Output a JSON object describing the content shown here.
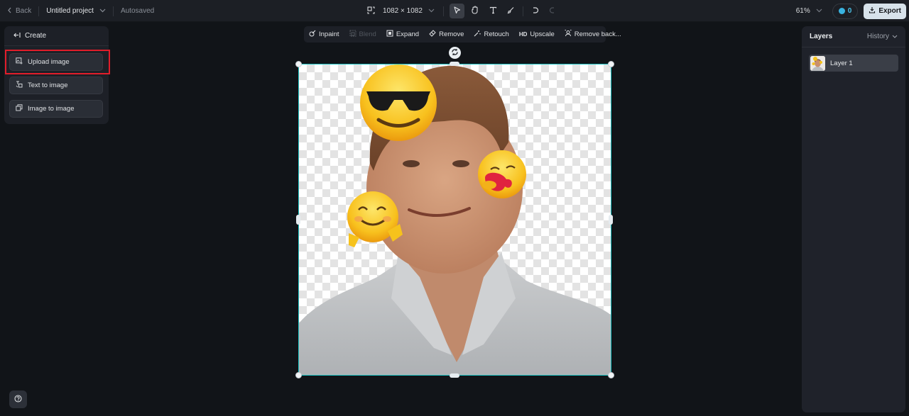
{
  "topbar": {
    "back_label": "Back",
    "project_name": "Untitled project",
    "save_status": "Autosaved",
    "canvas_size": "1082 × 1082",
    "zoom_level": "61%",
    "credits": "0",
    "export_label": "Export"
  },
  "tools": [
    {
      "name": "resize-icon"
    },
    {
      "name": "select-icon",
      "active": true
    },
    {
      "name": "hand-icon"
    },
    {
      "name": "text-icon"
    },
    {
      "name": "brush-icon"
    },
    {
      "name": "undo-icon"
    },
    {
      "name": "redo-icon",
      "disabled": true
    }
  ],
  "create_panel": {
    "title": "Create",
    "items": [
      {
        "label": "Upload image",
        "icon": "upload-image-icon",
        "highlighted": true
      },
      {
        "label": "Text to image",
        "icon": "text-to-image-icon"
      },
      {
        "label": "Image to image",
        "icon": "image-to-image-icon"
      }
    ]
  },
  "edit_toolbar": {
    "items": [
      {
        "label": "Inpaint",
        "icon": "inpaint-icon"
      },
      {
        "label": "Blend",
        "icon": "blend-icon",
        "disabled": true
      },
      {
        "label": "Expand",
        "icon": "expand-icon"
      },
      {
        "label": "Remove",
        "icon": "eraser-icon"
      },
      {
        "label": "Retouch",
        "icon": "magic-wand-icon"
      },
      {
        "label": "Upscale",
        "icon": "hd-icon",
        "icon_text": "HD"
      },
      {
        "label": "Remove back...",
        "icon": "remove-background-icon"
      }
    ]
  },
  "layers_panel": {
    "title": "Layers",
    "history_label": "History",
    "layers": [
      {
        "name": "Layer 1",
        "selected": true
      }
    ]
  },
  "colors": {
    "accent_selection": "#1fc4c4",
    "highlight_box": "#e11d2a",
    "export_bg": "#d7e2ea",
    "credits": "#4cc2e8"
  }
}
